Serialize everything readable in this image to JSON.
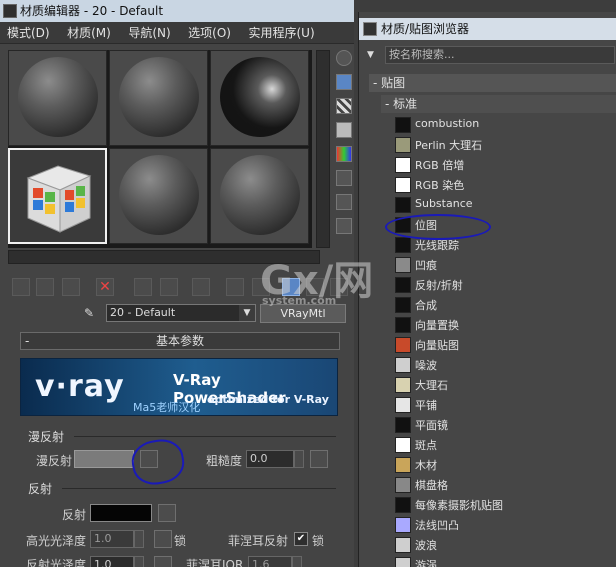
{
  "material_editor": {
    "title": "材质编辑器 - 20 - Default",
    "menu": [
      "模式(D)",
      "材质(M)",
      "导航(N)",
      "选项(O)",
      "实用程序(U)"
    ],
    "material_name": "20 - Default",
    "material_type": "VRayMtl",
    "rollout_title": "基本参数",
    "banner": {
      "logo": "v·ray",
      "title": "V-Ray PowerShader",
      "subtitle": "optimized for V-Ray",
      "credit": "Ma5老师汉化"
    },
    "diffuse_group": {
      "label": "漫反射",
      "diffuse_label": "漫反射",
      "roughness_label": "粗糙度",
      "roughness_value": "0.0"
    },
    "reflect_group": {
      "label": "反射",
      "reflect_label": "反射",
      "hilight_gloss_label": "高光光泽度",
      "hilight_gloss_value": "1.0",
      "lock_label": "锁",
      "fresnel_label": "菲涅耳反射",
      "fresnel_checked": "✔",
      "lock2_label": "锁",
      "refl_gloss_label": "反射光泽度",
      "refl_gloss_value": "1.0",
      "fresnel_ior_label": "菲涅耳IOR",
      "fresnel_ior_value": "1.6"
    }
  },
  "map_browser": {
    "title": "材质/贴图浏览器",
    "search_placeholder": "按名称搜索...",
    "category": "- 贴图",
    "subcategory": "- 标准",
    "items": [
      {
        "name": "combustion",
        "swatch": "#111111"
      },
      {
        "name": "Perlin 大理石",
        "swatch": "#9a9a7a"
      },
      {
        "name": "RGB 倍增",
        "swatch": "#ffffff"
      },
      {
        "name": "RGB 染色",
        "swatch": "#ffffff"
      },
      {
        "name": "Substance",
        "swatch": "#111111"
      },
      {
        "name": "位图",
        "swatch": "#111111"
      },
      {
        "name": "光线跟踪",
        "swatch": "#111111"
      },
      {
        "name": "凹痕",
        "swatch": "#8a8a8a"
      },
      {
        "name": "反射/折射",
        "swatch": "#111111"
      },
      {
        "name": "合成",
        "swatch": "#111111"
      },
      {
        "name": "向量置换",
        "swatch": "#111111"
      },
      {
        "name": "向量贴图",
        "swatch": "#c84a2a"
      },
      {
        "name": "噪波",
        "swatch": "#cfcfcf"
      },
      {
        "name": "大理石",
        "swatch": "#d8d2b0"
      },
      {
        "name": "平铺",
        "swatch": "#e6e6e6"
      },
      {
        "name": "平面镜",
        "swatch": "#111111"
      },
      {
        "name": "斑点",
        "swatch": "#ffffff"
      },
      {
        "name": "木材",
        "swatch": "#c9a55a"
      },
      {
        "name": "棋盘格",
        "swatch": "#888888"
      },
      {
        "name": "每像素摄影机贴图",
        "swatch": "#111111"
      },
      {
        "name": "法线凹凸",
        "swatch": "#a9a9ff"
      },
      {
        "name": "波浪",
        "swatch": "#cfcfcf"
      },
      {
        "name": "漩涡",
        "swatch": "#cfcfcf"
      }
    ]
  },
  "watermark": {
    "main": "Gx/网",
    "sub": "system.com"
  }
}
